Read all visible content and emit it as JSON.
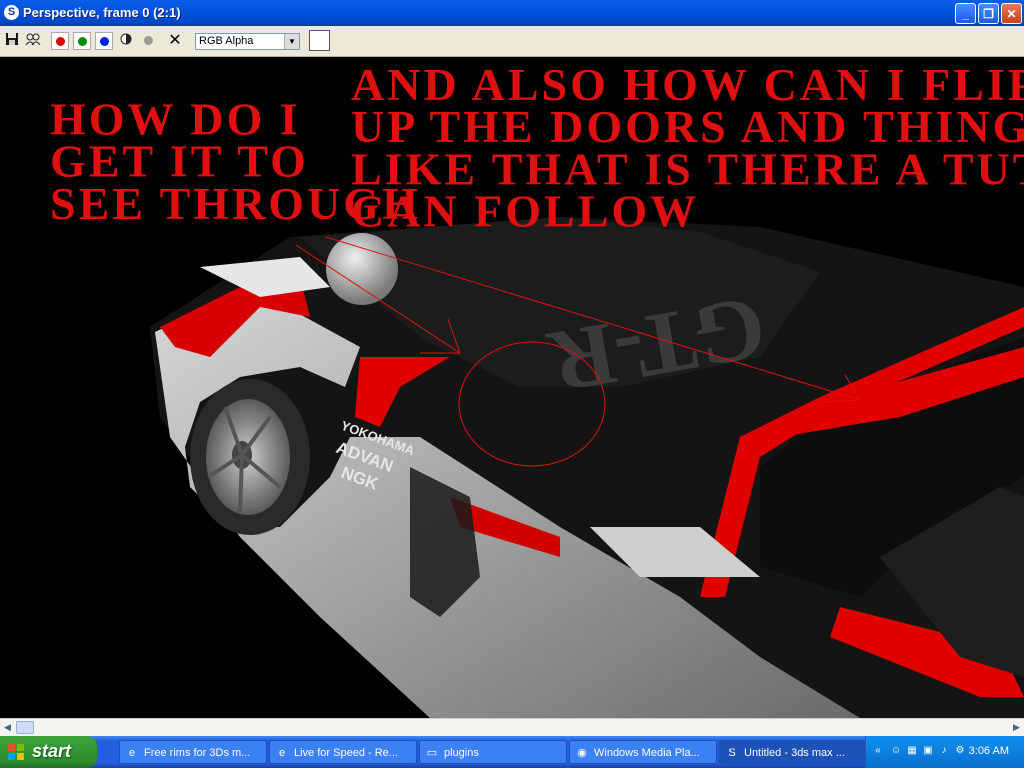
{
  "window": {
    "title": "Perspective, frame 0 (2:1)",
    "app_icon": "3ds-max-icon",
    "minimize": "_",
    "maximize": "❐",
    "close": "✕"
  },
  "toolbar": {
    "save_icon": "save-icon",
    "clone_icon": "clone-icon",
    "red_channel": "red-channel-toggle",
    "green_channel": "green-channel-toggle",
    "blue_channel": "blue-channel-toggle",
    "alpha_icon": "alpha-icon",
    "mono_icon": "mono-icon",
    "clear_icon": "clear-icon",
    "channel_value": "RGB Alpha",
    "swatch_color": "#ffffff"
  },
  "annotations": {
    "left_note": "HOW DO I\nGET IT TO\nSEE THROUGH",
    "right_note": "AND ALSO HOW CAN I FLIP\nUP THE DOORS AND THINGS\nLIKE THAT IS THERE A TUT I\nCAN FOLLOW"
  },
  "render": {
    "decal_ycorp": "YOKOHAMA",
    "decal_advan": "ADVAN",
    "decal_ngk": "NGK",
    "decal_gtr": "GT-R"
  },
  "taskbar": {
    "start_label": "start",
    "tasks": [
      {
        "label": "Free rims for 3Ds m...",
        "icon": "ie-icon"
      },
      {
        "label": "Live for Speed - Re...",
        "icon": "ie-icon"
      },
      {
        "label": "plugins",
        "icon": "folder-icon"
      },
      {
        "label": "Windows Media Pla...",
        "icon": "media-player-icon"
      },
      {
        "label": "Untitled - 3ds max ...",
        "icon": "3ds-max-icon"
      }
    ],
    "clock": "3:06 AM"
  },
  "colors": {
    "annotation_red": "#e01010",
    "car_red": "#e00000",
    "titlebar_blue": "#0053e0"
  }
}
